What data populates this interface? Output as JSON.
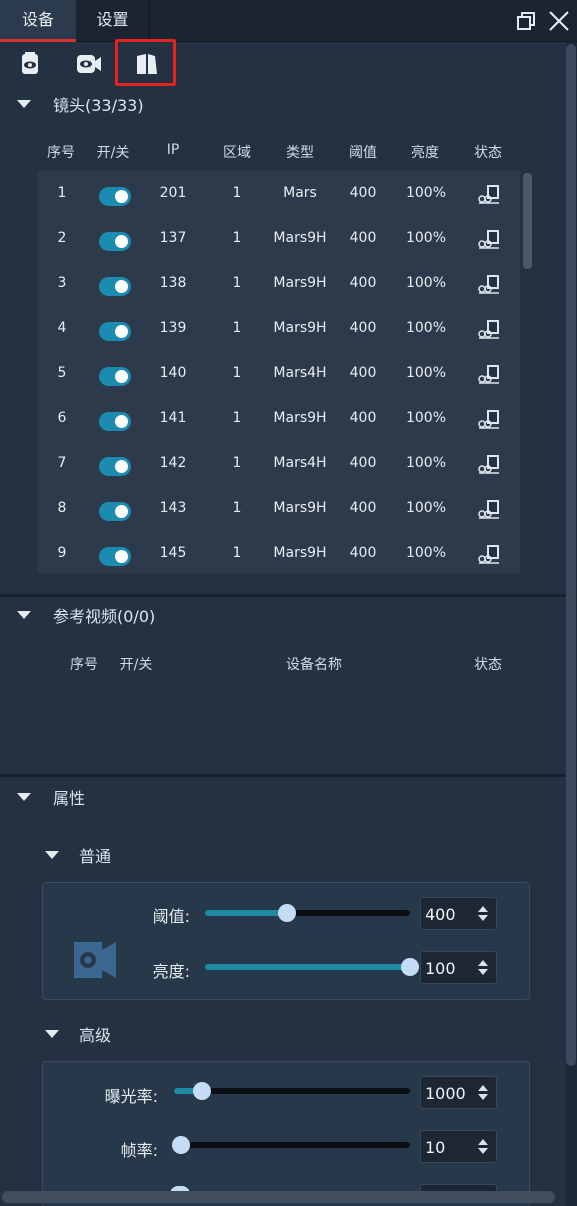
{
  "tabs": [
    {
      "label": "设备",
      "active": true
    },
    {
      "label": "设置",
      "active": false
    }
  ],
  "window_controls": {
    "restore_icon": "restore-window-icon",
    "close_icon": "close-icon"
  },
  "toolbar": [
    {
      "icon": "camera-eye-icon",
      "highlighted": false
    },
    {
      "icon": "video-camera-eye-icon",
      "highlighted": false
    },
    {
      "icon": "book-layout-icon",
      "highlighted": true
    }
  ],
  "lens_section": {
    "title": "镜头(33/33)",
    "columns": [
      "序号",
      "开/关",
      "IP",
      "区域",
      "类型",
      "阈值",
      "亮度",
      "状态"
    ],
    "rows": [
      {
        "no": "1",
        "on": true,
        "ip": "201",
        "zone": "1",
        "type": "Mars",
        "threshold": "400",
        "brightness": "100%",
        "status": "connected-device-icon"
      },
      {
        "no": "2",
        "on": true,
        "ip": "137",
        "zone": "1",
        "type": "Mars9H",
        "threshold": "400",
        "brightness": "100%",
        "status": "connected-device-icon"
      },
      {
        "no": "3",
        "on": true,
        "ip": "138",
        "zone": "1",
        "type": "Mars9H",
        "threshold": "400",
        "brightness": "100%",
        "status": "connected-device-icon"
      },
      {
        "no": "4",
        "on": true,
        "ip": "139",
        "zone": "1",
        "type": "Mars9H",
        "threshold": "400",
        "brightness": "100%",
        "status": "connected-device-icon"
      },
      {
        "no": "5",
        "on": true,
        "ip": "140",
        "zone": "1",
        "type": "Mars4H",
        "threshold": "400",
        "brightness": "100%",
        "status": "connected-device-icon"
      },
      {
        "no": "6",
        "on": true,
        "ip": "141",
        "zone": "1",
        "type": "Mars9H",
        "threshold": "400",
        "brightness": "100%",
        "status": "connected-device-icon"
      },
      {
        "no": "7",
        "on": true,
        "ip": "142",
        "zone": "1",
        "type": "Mars4H",
        "threshold": "400",
        "brightness": "100%",
        "status": "connected-device-icon"
      },
      {
        "no": "8",
        "on": true,
        "ip": "143",
        "zone": "1",
        "type": "Mars9H",
        "threshold": "400",
        "brightness": "100%",
        "status": "connected-device-icon"
      },
      {
        "no": "9",
        "on": true,
        "ip": "145",
        "zone": "1",
        "type": "Mars9H",
        "threshold": "400",
        "brightness": "100%",
        "status": "connected-device-icon"
      }
    ]
  },
  "reference_section": {
    "title": "参考视频(0/0)",
    "columns": [
      "序号",
      "开/关",
      "设备名称",
      "状态"
    ]
  },
  "properties_section": {
    "title": "属性",
    "general": {
      "title": "普通",
      "threshold_label": "阈值:",
      "threshold_value": "400",
      "threshold_fraction": 0.4,
      "brightness_label": "亮度:",
      "brightness_value": "100",
      "brightness_fraction": 1.0
    },
    "advanced": {
      "title": "高级",
      "exposure_label": "曝光率:",
      "exposure_value": "1000",
      "exposure_fraction": 0.12,
      "framerate_label": "帧率:",
      "framerate_value": "10",
      "framerate_fraction": 0.03
    }
  },
  "colors": {
    "accent": "#1f8aa5",
    "active_tab_border": "#d8322e",
    "highlight_box": "#e3231f",
    "background": "#243142"
  }
}
